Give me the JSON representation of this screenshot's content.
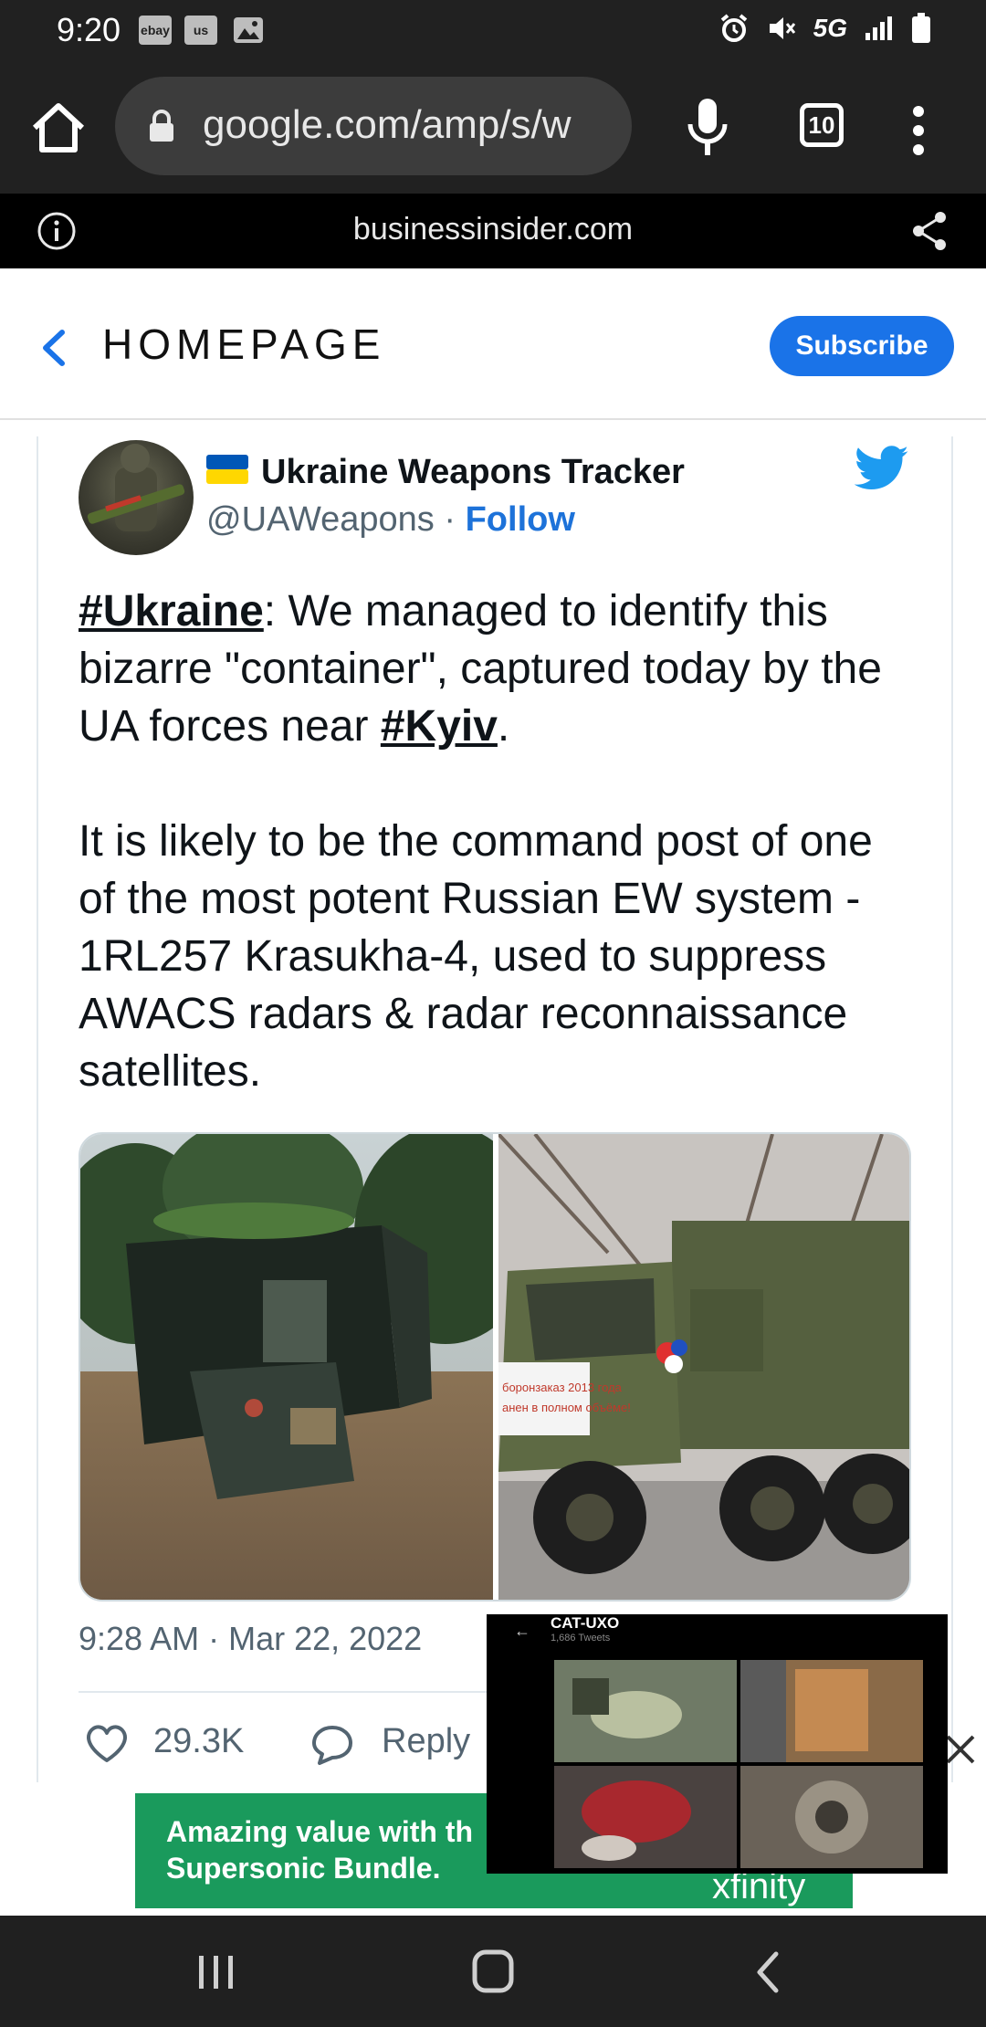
{
  "status_bar": {
    "time": "9:20",
    "left_icons": [
      "ebay",
      "us",
      "image-icon"
    ],
    "network": "5G",
    "right_icons": [
      "alarm-icon",
      "mute-icon",
      "5g-icon",
      "signal-icon",
      "battery-icon"
    ]
  },
  "browser": {
    "url": "google.com/amp/s/w",
    "tab_count": "10",
    "amp_domain": "businessinsider.com"
  },
  "page_header": {
    "section_label": "HOMEPAGE",
    "subscribe_label": "Subscribe"
  },
  "tweet": {
    "author_name": "Ukraine Weapons Tracker",
    "handle": "@UAWeapons",
    "separator": " · ",
    "follow_label": "Follow",
    "text": {
      "hashtag_ukraine": "#Ukraine",
      "part1": ": We managed to identify this bizarre \"container\", captured today by the UA forces near ",
      "hashtag_kyiv": "#Kyiv",
      "part2": ".",
      "paragraph2": "It is likely to be the command post of one of the most potent Russian EW system - 1RL257 Krasukha-4, used to suppress AWACS radars & radar reconnaissance satellites."
    },
    "media": {
      "right_image_banner_line1": "боронзаказ 2013 года",
      "right_image_banner_line2": "анен в полном объёме!"
    },
    "timestamp": "9:28 AM · Mar 22, 2022",
    "like_count": "29.3K",
    "reply_label": "Reply"
  },
  "ad": {
    "text_line1": "Amazing value with th",
    "text_line2": "Supersonic Bundle.",
    "brand": "xfinity"
  },
  "video_overlay": {
    "back_glyph": "←",
    "title": "CAT-UXO",
    "subtitle": "1,686 Tweets"
  },
  "colors": {
    "accent_blue": "#1a73e8",
    "twitter_blue": "#1d9bf0",
    "follow_blue": "#1d72d9",
    "ad_green": "#1a9a5c",
    "chrome_dark": "#212121"
  }
}
